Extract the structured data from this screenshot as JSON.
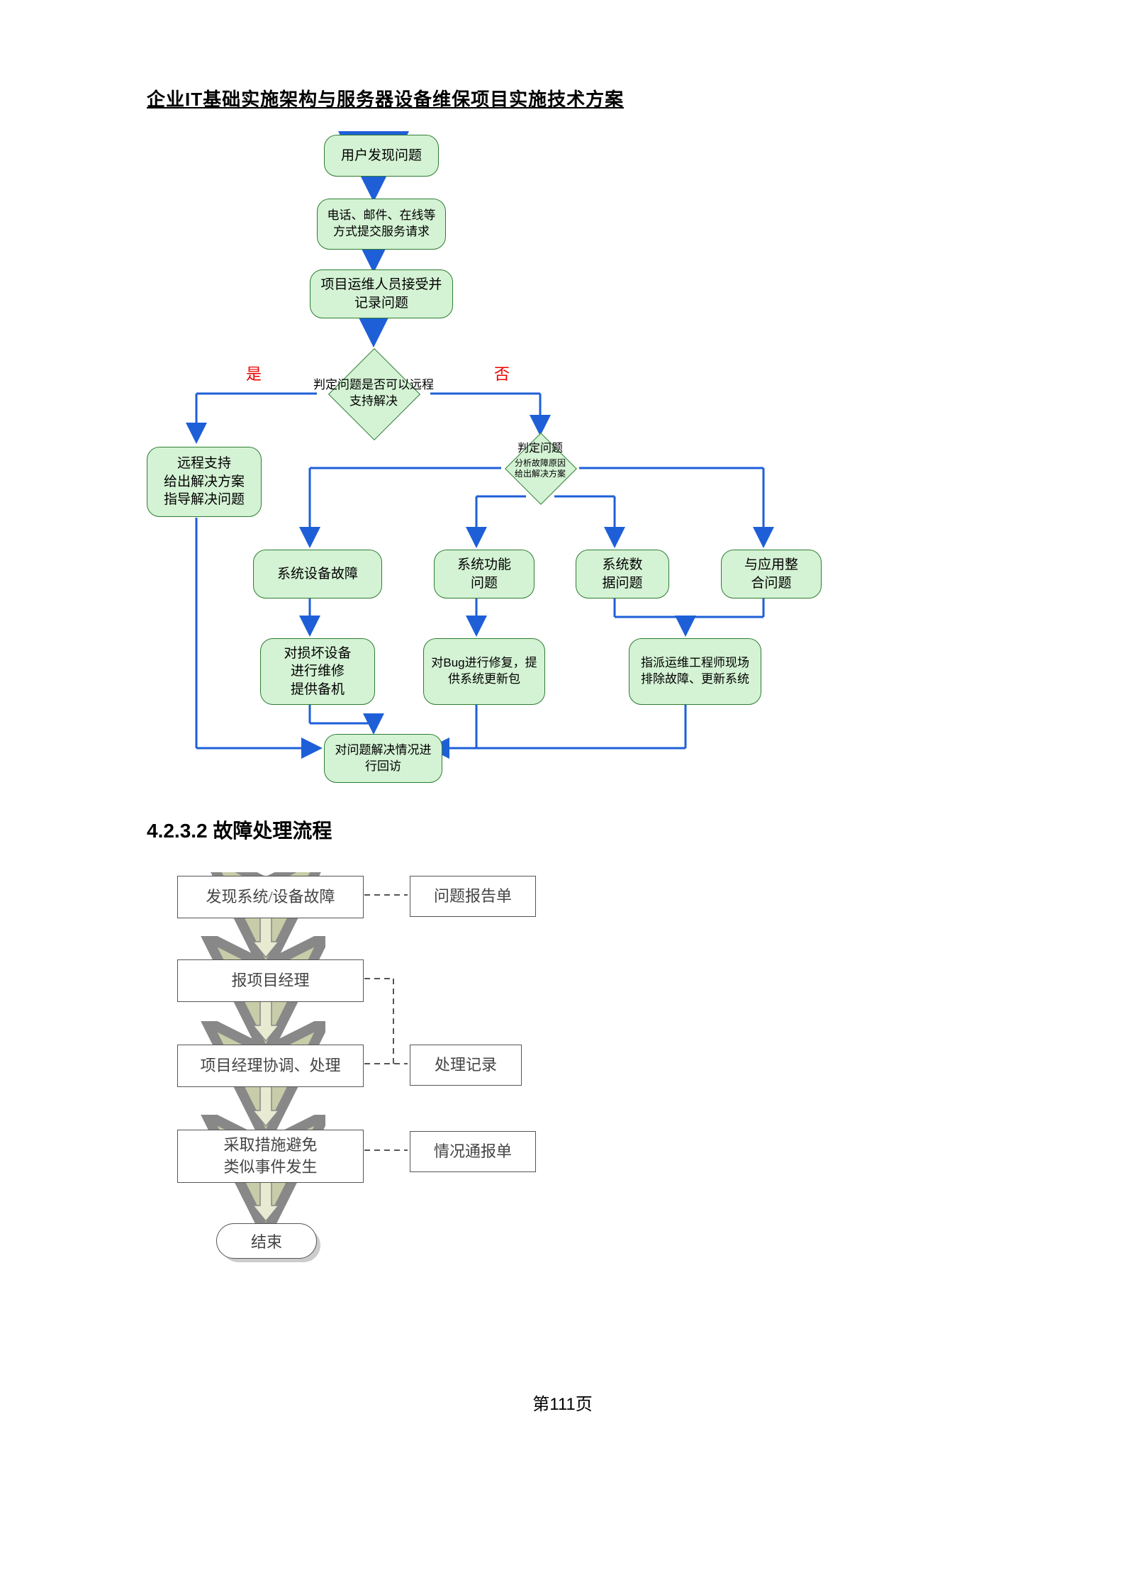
{
  "header": "企业IT基础实施架构与服务器设备维保项目实施技术方案",
  "section": "4.2.3.2  故障处理流程",
  "pageNumber": "第111页",
  "flow1": {
    "n1": "用户发现问题",
    "n2": "电话、邮件、在线等方式提交服务请求",
    "n3": "项目运维人员接受并记录问题",
    "d1": "判定问题是否可以远程支持解决",
    "yes": "是",
    "no": "否",
    "n4a": "远程支持\n给出解决方案\n指导解决问题",
    "d2_t": "判定问题",
    "d2_s1": "分析故障原因",
    "d2_s2": "给出解决方案",
    "c1": "系统设备故障",
    "c2": "系统功能\n问题",
    "c3": "系统数\n据问题",
    "c4": "与应用整\n合问题",
    "a1": "对损坏设备\n进行维修\n提供备机",
    "a2": "对Bug进行修复，提供系统更新包",
    "a3": "指派运维工程师现场排除故障、更新系统",
    "r1": "对问题解决情况进行回访"
  },
  "flow2": {
    "b1": "发现系统/设备故障",
    "s1": "问题报告单",
    "b2": "报项目经理",
    "b3": "项目经理协调、处理",
    "s2": "处理记录",
    "b4": "采取措施避免\n类似事件发生",
    "s3": "情况通报单",
    "end": "结束"
  }
}
